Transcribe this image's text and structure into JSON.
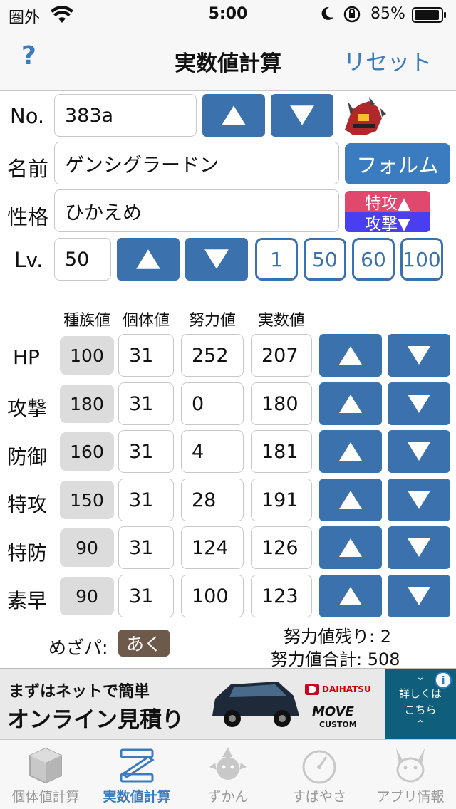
{
  "status": {
    "carrier": "圏外",
    "time": "5:00",
    "battery": "85%"
  },
  "nav": {
    "help": "?",
    "title": "実数値計算",
    "reset": "リセット"
  },
  "form": {
    "no_label": "No.",
    "no_value": "383a",
    "name_label": "名前",
    "name_value": "ゲンシグラードン",
    "form_button": "フォルム",
    "nature_label": "性格",
    "nature_value": "ひかえめ",
    "nature_up": "特攻▲",
    "nature_down": "攻撃▼",
    "lv_label": "Lv.",
    "lv_value": "50",
    "lv_presets": [
      "1",
      "50",
      "60",
      "100"
    ]
  },
  "stats": {
    "headers": [
      "種族値",
      "個体値",
      "努力値",
      "実数値"
    ],
    "rows": [
      {
        "label": "HP",
        "base": "100",
        "iv": "31",
        "ev": "252",
        "actual": "207"
      },
      {
        "label": "攻撃",
        "base": "180",
        "iv": "31",
        "ev": "0",
        "actual": "180"
      },
      {
        "label": "防御",
        "base": "160",
        "iv": "31",
        "ev": "4",
        "actual": "181"
      },
      {
        "label": "特攻",
        "base": "150",
        "iv": "31",
        "ev": "28",
        "actual": "191"
      },
      {
        "label": "特防",
        "base": "90",
        "iv": "31",
        "ev": "124",
        "actual": "126"
      },
      {
        "label": "素早",
        "base": "90",
        "iv": "31",
        "ev": "100",
        "actual": "123"
      }
    ]
  },
  "summary": {
    "hidden_power_label": "めざパ:",
    "hidden_power_type": "あく",
    "ev_remaining": "努力値残り: 2",
    "ev_total": "努力値合計: 508"
  },
  "ad": {
    "line1": "まずはネットで簡単",
    "line2": "オンライン見積り",
    "brand": "DAIHATSU",
    "model": "MOVE",
    "model_sub": "CUSTOM",
    "side1": "詳しくは",
    "side2": "こちら"
  },
  "tabs": [
    {
      "label": "個体値計算",
      "icon": "cube-icon",
      "active": false
    },
    {
      "label": "実数値計算",
      "icon": "ruler-z-icon",
      "active": true
    },
    {
      "label": "ずかん",
      "icon": "pokemon-silhouette-icon",
      "active": false
    },
    {
      "label": "すばやさ",
      "icon": "speedometer-icon",
      "active": false
    },
    {
      "label": "アプリ情報",
      "icon": "pikachu-icon",
      "active": false
    }
  ],
  "colors": {
    "accent": "#3b72ad",
    "link": "#3a7cc0",
    "nature_up": "#e0486e",
    "nature_down": "#4a3ff0",
    "dark_type": "#6e5a4a"
  }
}
